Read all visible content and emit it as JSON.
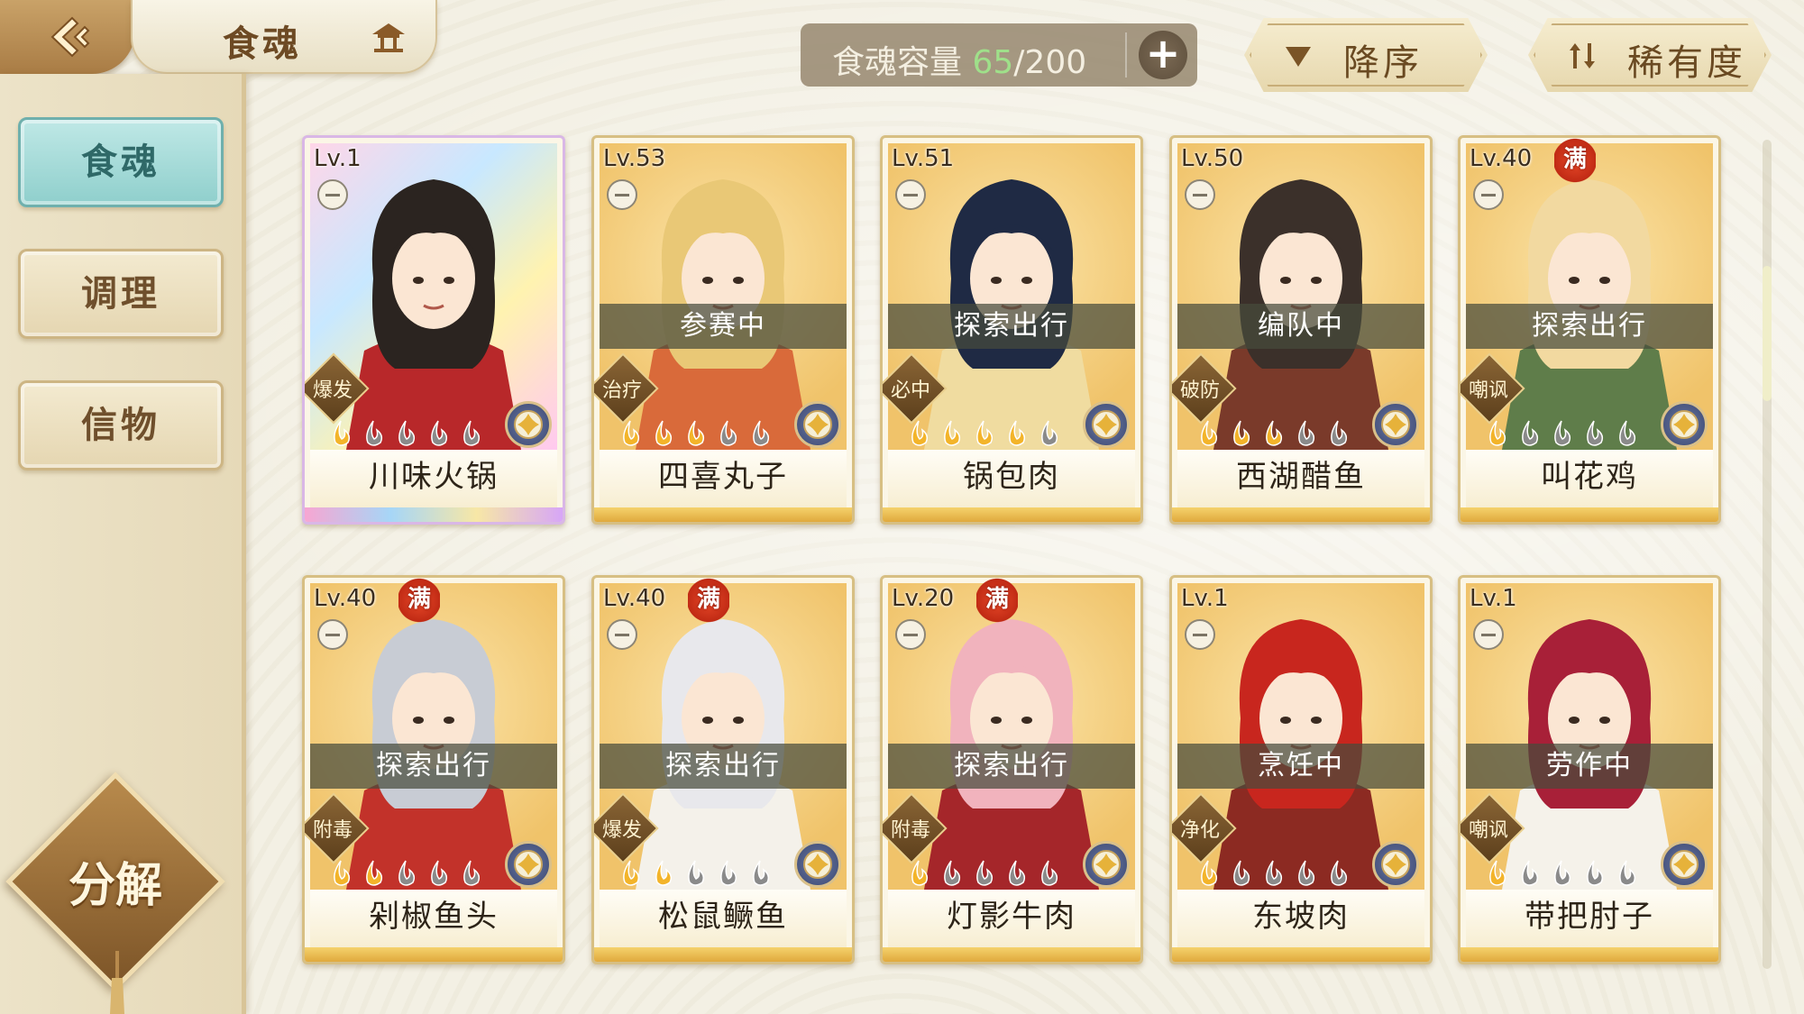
{
  "header": {
    "title": "食魂",
    "capacity_label": "食魂容量",
    "capacity_current": "65",
    "capacity_max": "/200",
    "add_label": "+"
  },
  "sort": {
    "order_label": "降序",
    "rarity_label": "稀有度"
  },
  "sidebar": {
    "items": [
      {
        "label": "食魂",
        "active": true
      },
      {
        "label": "调理",
        "active": false
      },
      {
        "label": "信物",
        "active": false
      }
    ],
    "decompose_label": "分解"
  },
  "colors": {
    "accent_teal": "#8fcfcc",
    "capacity_green": "#9fe08a",
    "card_gold": "#f0c36a",
    "flame_lit": "#f3b42a",
    "flame_dim": "#8a8a8a"
  },
  "cards": [
    {
      "level": "Lv.1",
      "name": "川味火锅",
      "role": "爆发",
      "status": "",
      "maxed": "",
      "stars": 1,
      "rainbow": true,
      "hair": "#2b2420",
      "cloth": "#b8282a"
    },
    {
      "level": "Lv.53",
      "name": "四喜丸子",
      "role": "治疗",
      "status": "参赛中",
      "maxed": "",
      "stars": 3,
      "rainbow": false,
      "hair": "#e9c876",
      "cloth": "#d96a3a"
    },
    {
      "level": "Lv.51",
      "name": "锅包肉",
      "role": "必中",
      "status": "探索出行",
      "maxed": "",
      "stars": 4,
      "rainbow": false,
      "hair": "#1f2a44",
      "cloth": "#f0dca0"
    },
    {
      "level": "Lv.50",
      "name": "西湖醋鱼",
      "role": "破防",
      "status": "编队中",
      "maxed": "",
      "stars": 3,
      "rainbow": false,
      "hair": "#3b302a",
      "cloth": "#7a3a2a"
    },
    {
      "level": "Lv.40",
      "name": "叫花鸡",
      "role": "嘲讽",
      "status": "探索出行",
      "maxed": "满",
      "stars": 1,
      "rainbow": false,
      "hair": "#f2d9a0",
      "cloth": "#5f7d4a"
    },
    {
      "level": "Lv.40",
      "name": "剁椒鱼头",
      "role": "附毒",
      "status": "探索出行",
      "maxed": "满",
      "stars": 2,
      "rainbow": false,
      "hair": "#c8ccd4",
      "cloth": "#c2322a"
    },
    {
      "level": "Lv.40",
      "name": "松鼠鳜鱼",
      "role": "爆发",
      "status": "探索出行",
      "maxed": "满",
      "stars": 2,
      "rainbow": false,
      "hair": "#e8e8ec",
      "cloth": "#f4f1ea"
    },
    {
      "level": "Lv.20",
      "name": "灯影牛肉",
      "role": "附毒",
      "status": "探索出行",
      "maxed": "满",
      "stars": 1,
      "rainbow": false,
      "hair": "#f1b3bd",
      "cloth": "#a5262a"
    },
    {
      "level": "Lv.1",
      "name": "东坡肉",
      "role": "净化",
      "status": "烹饪中",
      "maxed": "",
      "stars": 1,
      "rainbow": false,
      "hair": "#c8261e",
      "cloth": "#8c2a22"
    },
    {
      "level": "Lv.1",
      "name": "带把肘子",
      "role": "嘲讽",
      "status": "劳作中",
      "maxed": "",
      "stars": 1,
      "rainbow": false,
      "hair": "#a82038",
      "cloth": "#f5f2ea"
    }
  ]
}
